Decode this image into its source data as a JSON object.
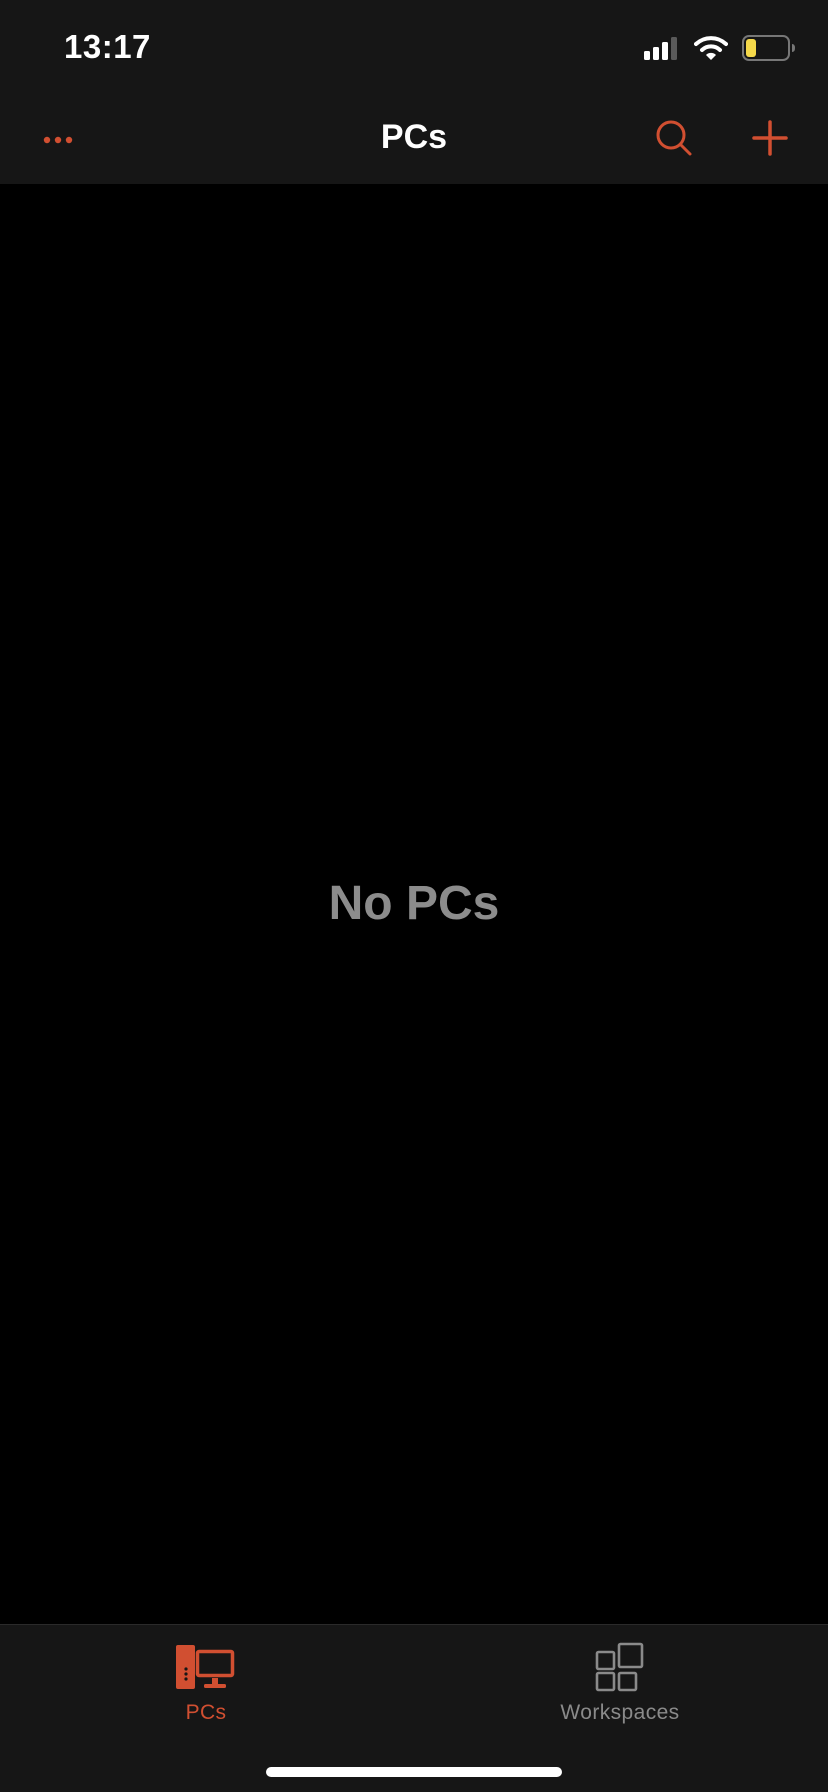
{
  "status_bar": {
    "time": "13:17",
    "icons": [
      "signal-icon",
      "wifi-icon",
      "battery-icon"
    ],
    "battery_level": 0.25
  },
  "nav": {
    "title": "PCs",
    "left_icon": "more-icon",
    "right_icons": [
      "search-icon",
      "add-icon"
    ]
  },
  "main": {
    "empty_message": "No PCs"
  },
  "tabs": [
    {
      "label": "PCs",
      "icon": "pc-icon",
      "selected": true
    },
    {
      "label": "Workspaces",
      "icon": "workspaces-icon",
      "selected": false
    }
  ],
  "colors": {
    "accent": "#d14f31",
    "bar_background": "#161616",
    "content_background": "#000000",
    "muted_text": "#8c8c8c",
    "inactive_tab": "#8a8a8a",
    "battery_fill": "#f5d94a"
  }
}
